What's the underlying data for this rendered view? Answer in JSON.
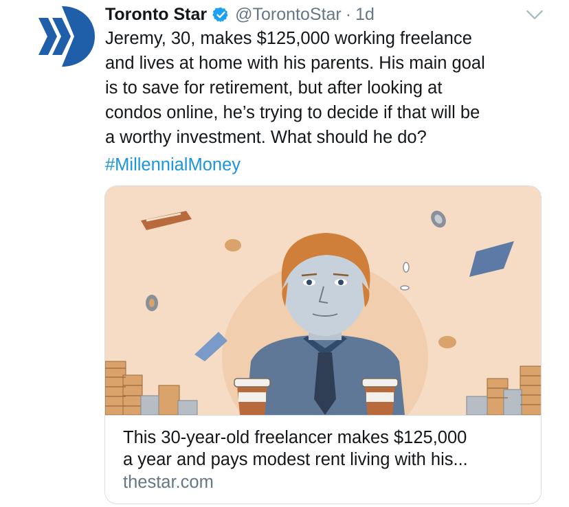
{
  "tweet": {
    "display_name": "Toronto Star",
    "handle": "@TorontoStar",
    "separator": "·",
    "time": "1d",
    "text": "Jeremy, 30, makes $125,000 working freelance\nand lives at home with his parents. His main goal\nis to save for retirement, but after looking at\ncondos online, he’s trying to decide if that will be\na worthy investment. What should he do?",
    "hashtag": "#MillennialMoney",
    "avatar_icon": "toronto-star-logo",
    "verified_icon": "verified-badge-icon",
    "menu_icon": "chevron-down-icon"
  },
  "card": {
    "title": "This 30-year-old freelancer makes $125,000\na year and pays modest rent living with his...",
    "domain": "thestar.com",
    "image_description_icon": "article-illustration"
  },
  "colors": {
    "brand_blue": "#1f5ea8",
    "link_blue": "#1b95e0",
    "muted_gray": "#657786",
    "card_bg": "#f6dcc4"
  }
}
